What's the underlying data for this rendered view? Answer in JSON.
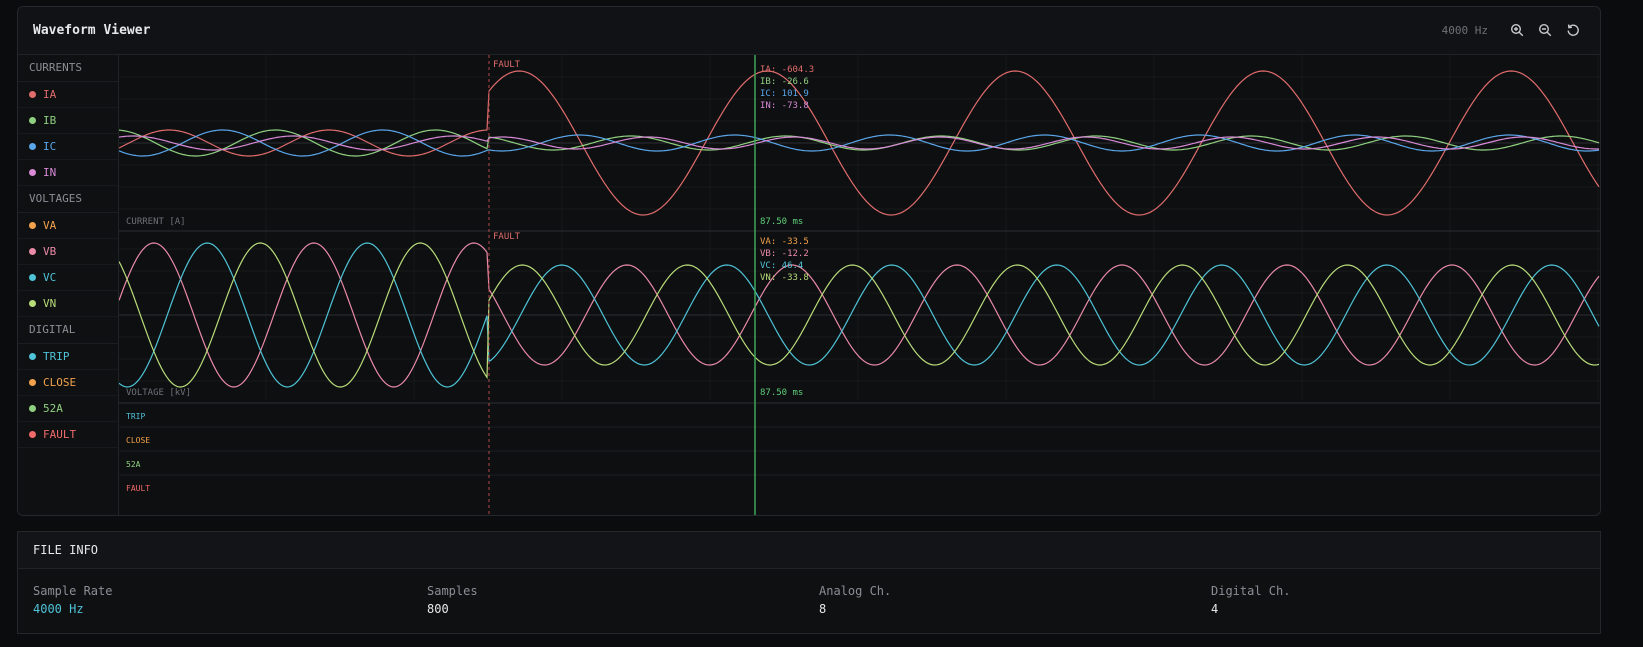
{
  "viewer": {
    "title": "Waveform Viewer",
    "rate": "4000 Hz",
    "buttons": [
      "zoom-in-icon",
      "zoom-out-icon",
      "reset-icon"
    ]
  },
  "sidebar": {
    "groups": [
      {
        "title": "CURRENTS",
        "channels": [
          {
            "label": "IA",
            "color": "#e06c6c"
          },
          {
            "label": "IB",
            "color": "#8fd080"
          },
          {
            "label": "IC",
            "color": "#5aa6ea"
          },
          {
            "label": "IN",
            "color": "#d88ad6"
          }
        ]
      },
      {
        "title": "VOLTAGES",
        "channels": [
          {
            "label": "VA",
            "color": "#f2a24a"
          },
          {
            "label": "VB",
            "color": "#e98aa6"
          },
          {
            "label": "VC",
            "color": "#4fc3d7"
          },
          {
            "label": "VN",
            "color": "#b9dc7a"
          }
        ]
      },
      {
        "title": "DIGITAL",
        "channels": [
          {
            "label": "TRIP",
            "color": "#4fc3d7"
          },
          {
            "label": "CLOSE",
            "color": "#f2a24a"
          },
          {
            "label": "52A",
            "color": "#8fd080"
          },
          {
            "label": "FAULT",
            "color": "#f06a6a"
          }
        ]
      }
    ]
  },
  "plots": {
    "current_label": "CURRENT [A]",
    "voltage_label": "VOLTAGE [kV]",
    "fault_label": "FAULT",
    "cursor_time": "87.50 ms",
    "current_readout": [
      {
        "name": "IA:",
        "value": "-604.3",
        "color": "#e06c6c"
      },
      {
        "name": "IB:",
        "value": "-26.6",
        "color": "#8fd080"
      },
      {
        "name": "IC:",
        "value": "101.9",
        "color": "#5aa6ea"
      },
      {
        "name": "IN:",
        "value": "-73.8",
        "color": "#d88ad6"
      }
    ],
    "voltage_readout": [
      {
        "name": "VA:",
        "value": "-33.5",
        "color": "#f2a24a"
      },
      {
        "name": "VB:",
        "value": "-12.2",
        "color": "#e98aa6"
      },
      {
        "name": "VC:",
        "value": "46.4",
        "color": "#4fc3d7"
      },
      {
        "name": "VN:",
        "value": "-33.8",
        "color": "#b9dc7a"
      }
    ],
    "digital_rows": [
      {
        "label": "TRIP",
        "color": "#4fc3d7"
      },
      {
        "label": "CLOSE",
        "color": "#f2a24a"
      },
      {
        "label": "52A",
        "color": "#8fd080"
      },
      {
        "label": "FAULT",
        "color": "#f06a6a"
      }
    ]
  },
  "file_info": {
    "title": "FILE INFO",
    "stats": [
      {
        "label": "Sample Rate",
        "value": "4000 Hz"
      },
      {
        "label": "Samples",
        "value": "800"
      },
      {
        "label": "Analog Ch.",
        "value": "8"
      },
      {
        "label": "Digital Ch.",
        "value": "4"
      }
    ]
  }
}
